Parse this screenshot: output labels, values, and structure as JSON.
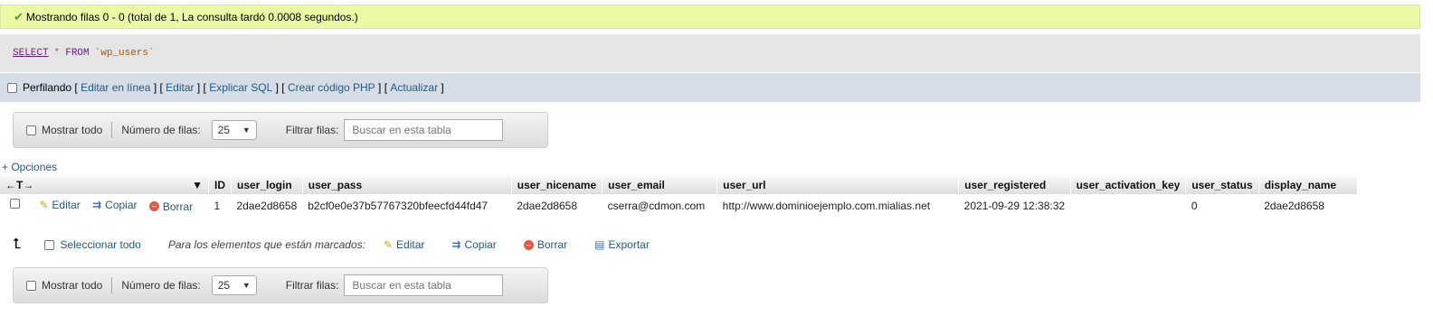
{
  "success": {
    "message": "Mostrando filas 0 - 0 (total de 1, La consulta tardó 0.0008 segundos.)"
  },
  "sql": {
    "select": "SELECT",
    "star": "*",
    "from": "FROM",
    "table": "`wp_users`"
  },
  "options_bar": {
    "profiling": "Perfilando",
    "open1": "[",
    "inline_edit": "Editar en línea",
    "close1": "] [",
    "edit": "Editar",
    "close2": "] [",
    "explain": "Explicar SQL",
    "close3": "] [",
    "php": "Crear código PHP",
    "close4": "] [",
    "refresh": "Actualizar",
    "close5": "]"
  },
  "nav": {
    "show_all": "Mostrar todo",
    "rows_label": "Número de filas:",
    "rows_value": "25",
    "filter_label": "Filtrar filas:",
    "search_placeholder": "Buscar en esta tabla"
  },
  "opciones": "+ Opciones",
  "table": {
    "arrows": "←T→",
    "sort_icon": "▼",
    "columns": [
      "ID",
      "user_login",
      "user_pass",
      "user_nicename",
      "user_email",
      "user_url",
      "user_registered",
      "user_activation_key",
      "user_status",
      "display_name"
    ],
    "row": {
      "edit": "Editar",
      "copy": "Copiar",
      "delete": "Borrar",
      "cells": [
        "1",
        "2dae2d8658",
        "b2cf0e0e37b57767320bfeecfd44fd47",
        "2dae2d8658",
        "cserra@cdmon.com",
        "http://www.dominioejemplo.com.mialias.net",
        "2021-09-29 12:38:32",
        "",
        "0",
        "2dae2d8658"
      ]
    }
  },
  "bulk": {
    "select_all": "Seleccionar todo",
    "marked_label": "Para los elementos que están marcados:",
    "edit": "Editar",
    "copy": "Copiar",
    "delete": "Borrar",
    "export": "Exportar"
  },
  "colors": {
    "success_bg": "#ebf8a4",
    "link": "#235a81",
    "options_bg": "#d5dde6"
  }
}
